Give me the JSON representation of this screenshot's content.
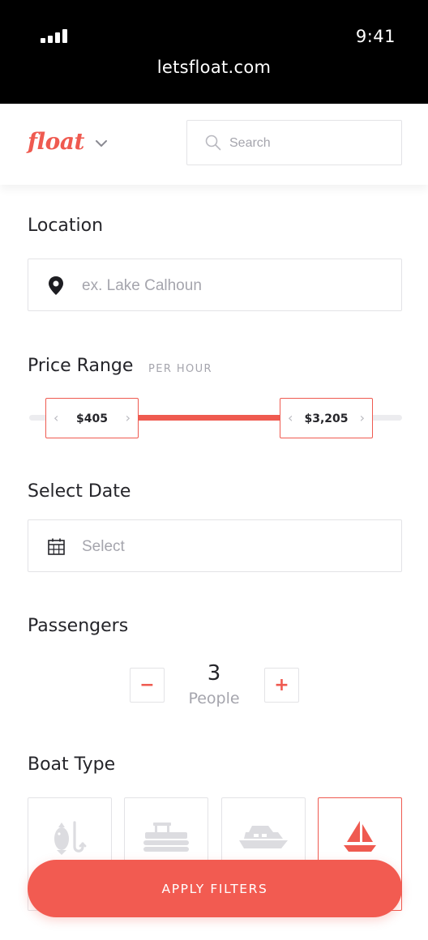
{
  "statusbar": {
    "time": "9:41",
    "url": "letsfloat.com"
  },
  "header": {
    "logo": "float",
    "search_placeholder": "Search"
  },
  "location": {
    "title": "Location",
    "placeholder": "ex. Lake Calhoun",
    "icon": "map-pin-icon"
  },
  "price": {
    "title": "Price Range",
    "unit": "PER HOUR",
    "min_label": "$405",
    "max_label": "$3,205"
  },
  "date": {
    "title": "Select Date",
    "placeholder": "Select",
    "icon": "calendar-icon"
  },
  "passengers": {
    "title": "Passengers",
    "count": "3",
    "unit": "People",
    "minus": "−",
    "plus": "+"
  },
  "boat_type": {
    "title": "Boat Type",
    "options": [
      {
        "icon": "fishing-boat-icon",
        "selected": false
      },
      {
        "icon": "pontoon-boat-icon",
        "selected": false
      },
      {
        "icon": "yacht-icon",
        "selected": false
      },
      {
        "icon": "sailboat-icon",
        "selected": true
      }
    ]
  },
  "apply_label": "APPLY FILTERS",
  "colors": {
    "accent": "#ef5a50",
    "muted": "#a5a5ad",
    "border": "#e3e3e6",
    "text": "#25252a",
    "icon_inactive": "#dcdce0"
  }
}
